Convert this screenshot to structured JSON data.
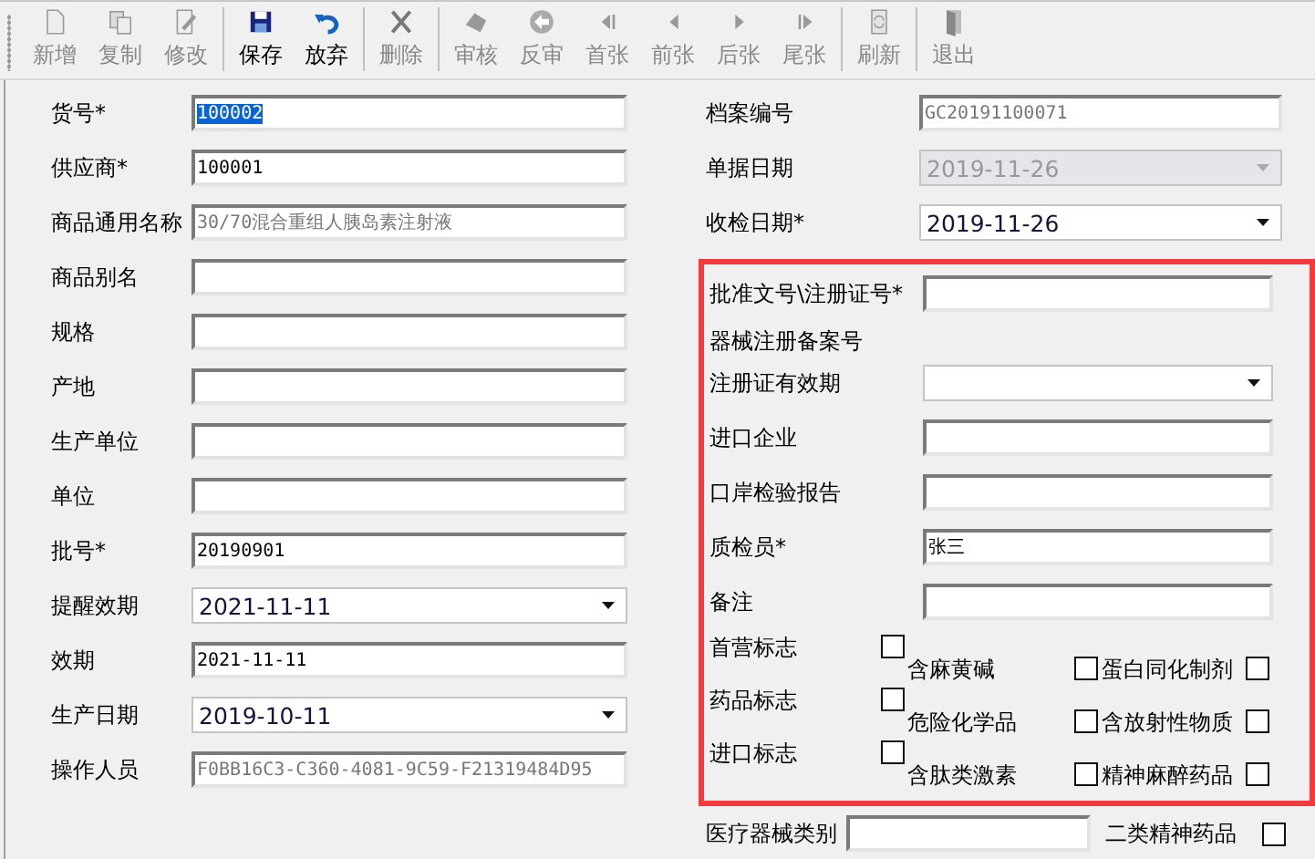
{
  "toolbar": {
    "groups": [
      {
        "buttons": [
          {
            "label": "新增",
            "kind": "new",
            "disabled": true
          },
          {
            "label": "复制",
            "kind": "copy",
            "disabled": true
          },
          {
            "label": "修改",
            "kind": "edit",
            "disabled": true
          }
        ]
      },
      {
        "buttons": [
          {
            "label": "保存",
            "kind": "save",
            "disabled": false
          },
          {
            "label": "放弃",
            "kind": "undo",
            "disabled": false
          }
        ]
      },
      {
        "buttons": [
          {
            "label": "删除",
            "kind": "delete",
            "disabled": true
          }
        ]
      },
      {
        "buttons": [
          {
            "label": "审核",
            "kind": "approve",
            "disabled": true
          },
          {
            "label": "反审",
            "kind": "back",
            "disabled": true
          },
          {
            "label": "首张",
            "kind": "first",
            "disabled": true
          },
          {
            "label": "前张",
            "kind": "prev",
            "disabled": true
          },
          {
            "label": "后张",
            "kind": "next",
            "disabled": true
          },
          {
            "label": "尾张",
            "kind": "last",
            "disabled": true
          }
        ]
      },
      {
        "buttons": [
          {
            "label": "刷新",
            "kind": "refresh",
            "disabled": true
          }
        ]
      },
      {
        "buttons": [
          {
            "label": "退出",
            "kind": "exit",
            "disabled": true
          }
        ]
      }
    ]
  },
  "left_fields": [
    {
      "label": "货号*",
      "kind": "text",
      "value": "100002",
      "text_selected": true
    },
    {
      "label": "供应商*",
      "kind": "text",
      "value": "100001"
    },
    {
      "label": "商品通用名称",
      "kind": "text",
      "value": "30/70混合重组人胰岛素注射液",
      "readonly": true
    },
    {
      "label": "商品别名",
      "kind": "text"
    },
    {
      "label": "规格",
      "kind": "text"
    },
    {
      "label": "产地",
      "kind": "text"
    },
    {
      "label": "生产单位",
      "kind": "text"
    },
    {
      "label": "单位",
      "kind": "text"
    },
    {
      "label": "批号*",
      "kind": "text",
      "value": "20190901"
    },
    {
      "label": "提醒效期",
      "kind": "dropdown",
      "value": "2021-11-11"
    },
    {
      "label": "效期",
      "kind": "text",
      "value": "2021-11-11"
    },
    {
      "label": "生产日期",
      "kind": "dropdown",
      "value": "2019-10-11"
    },
    {
      "label": "操作人员",
      "kind": "text",
      "value": "F0BB16C3-C360-4081-9C59-F21319484D95",
      "readonly": true
    }
  ],
  "right_fields": [
    {
      "label": "档案编号",
      "kind": "text",
      "value": "GC20191100071",
      "readonly": true
    },
    {
      "label": "单据日期",
      "kind": "dropdown",
      "value": "2019-11-26",
      "disabled": true
    },
    {
      "label": "收检日期*",
      "kind": "dropdown",
      "value": "2019-11-26"
    }
  ],
  "highlighted_section": {
    "fields": [
      {
        "label": "批准文号\\注册证号*",
        "sublabel": "器械注册备案号",
        "kind": "text"
      },
      {
        "label": "注册证有效期",
        "kind": "dropdown"
      },
      {
        "label": "进口企业",
        "kind": "text"
      },
      {
        "label": "口岸检验报告",
        "kind": "text"
      },
      {
        "label": "质检员*",
        "kind": "text",
        "value": "张三"
      },
      {
        "label": "备注",
        "kind": "text"
      }
    ],
    "flag_columns": [
      {
        "flags": [
          {
            "label": "首营标志",
            "checked": false
          },
          {
            "label": "药品标志",
            "checked": false
          },
          {
            "label": "进口标志",
            "checked": false
          }
        ]
      },
      {
        "flags": [
          {
            "label": "含麻黄碱",
            "checked": false
          },
          {
            "label": "危险化学品",
            "checked": false
          },
          {
            "label": "含肽类激素",
            "checked": false
          }
        ]
      },
      {
        "flags": [
          {
            "label": "蛋白同化制剂",
            "checked": false
          },
          {
            "label": "含放射性物质",
            "checked": false
          },
          {
            "label": "精神麻醉药品",
            "checked": false
          }
        ]
      }
    ]
  },
  "bottom_row": {
    "field": {
      "label": "医疗器械类别"
    },
    "flag": {
      "label": "二类精神药品",
      "checked": false
    }
  }
}
